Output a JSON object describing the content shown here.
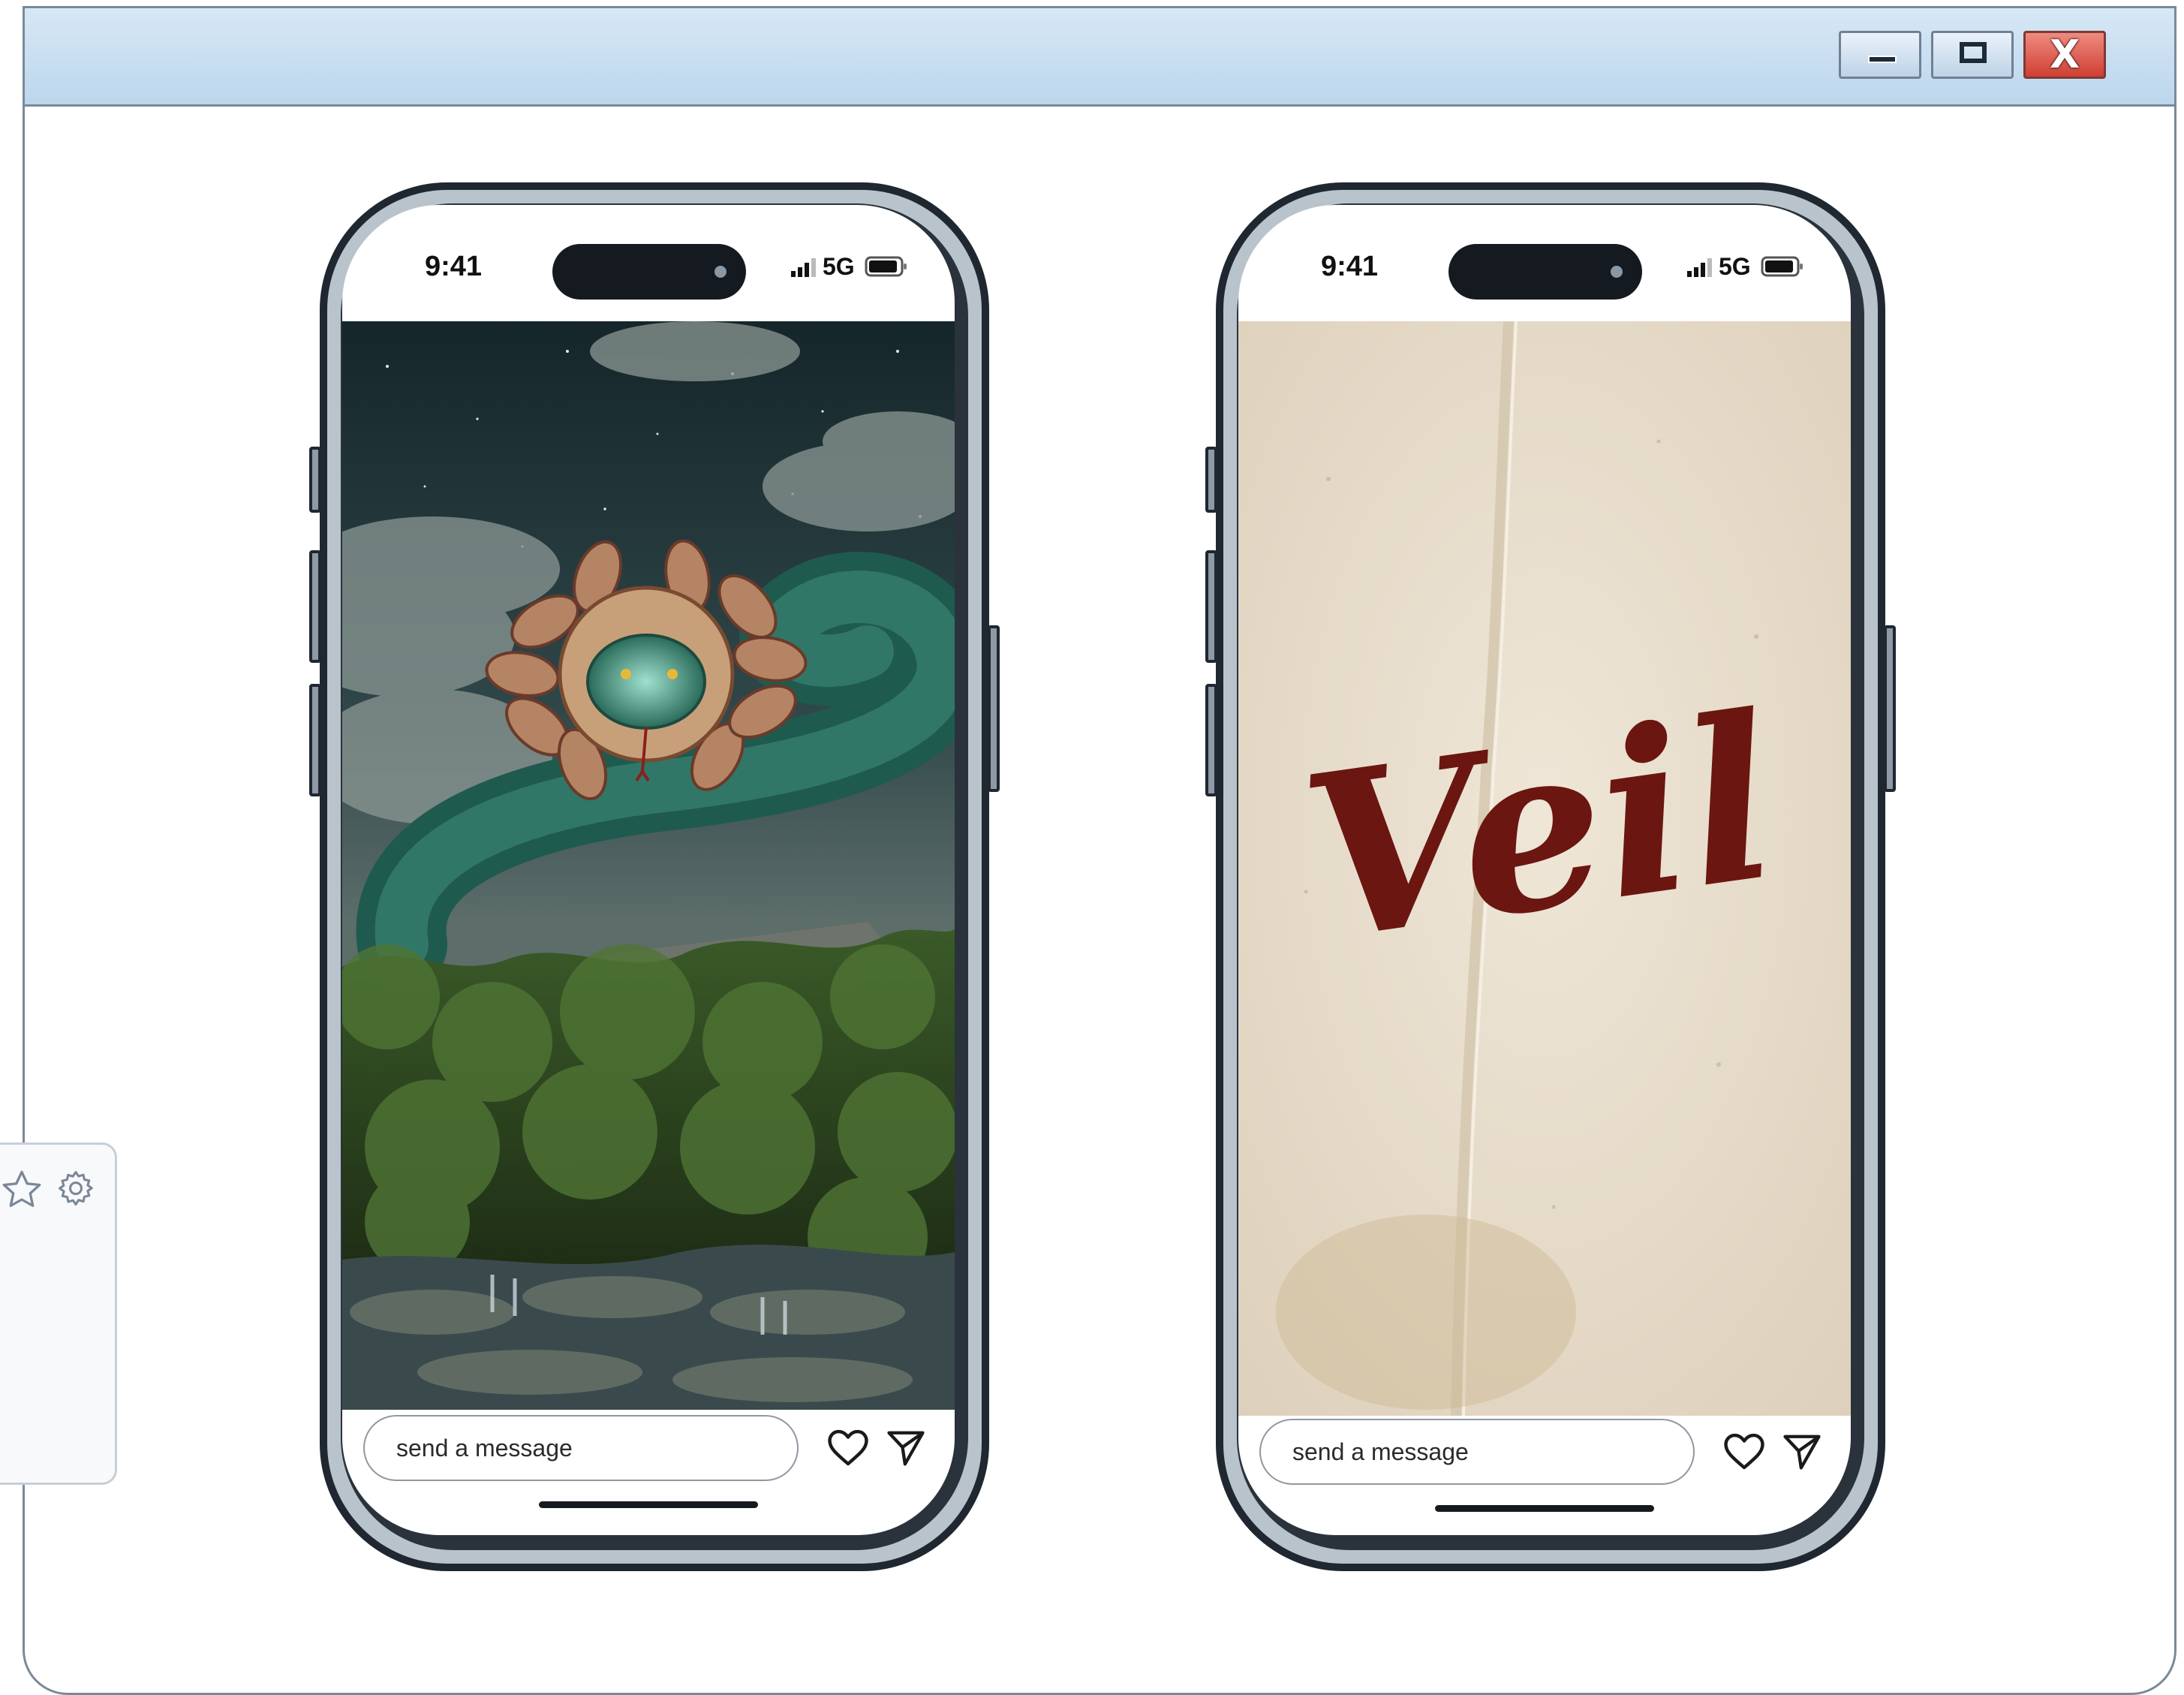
{
  "window": {
    "controls": {
      "minimize": "minimize",
      "maximize": "maximize",
      "close": "X"
    }
  },
  "phones": [
    {
      "status": {
        "time": "9:41",
        "network": "5G"
      },
      "media": {
        "subject": "feathered-serpent-over-jungle-temple-image"
      },
      "composer": {
        "placeholder": "send a message"
      }
    },
    {
      "status": {
        "time": "9:41",
        "network": "5G"
      },
      "media": {
        "script_text": "Veil"
      },
      "composer": {
        "placeholder": "send a message"
      }
    }
  ],
  "side_widget": {
    "icons": [
      "star-icon",
      "gear-icon"
    ]
  },
  "colors": {
    "titlebar": "#c8def0",
    "close": "#d9473b",
    "phone_frame": "#1f2731",
    "parchment": "#e9dfcf",
    "ink": "#6b1610"
  }
}
